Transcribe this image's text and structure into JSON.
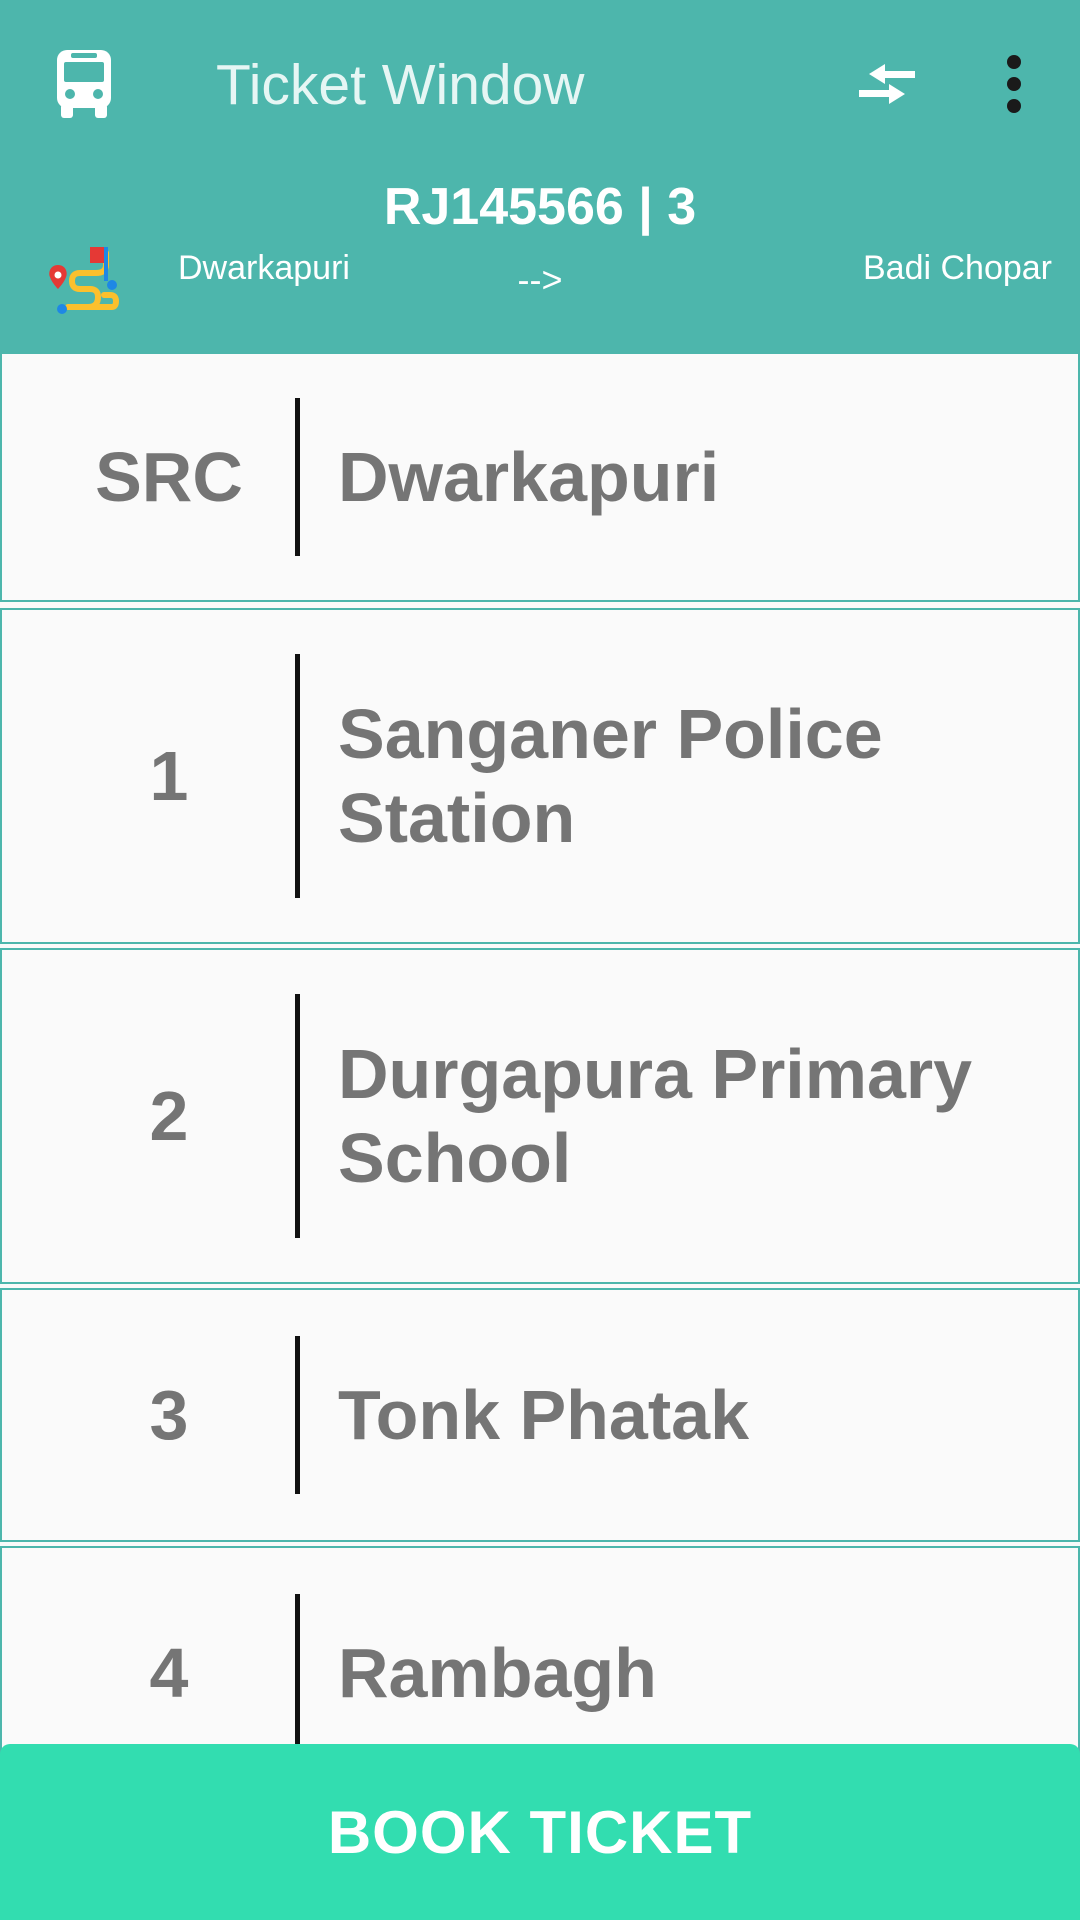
{
  "header": {
    "title": "Ticket Window",
    "route_code": "RJ145566 | 3",
    "source": "Dwarkapuri",
    "arrow": "-->",
    "destination": "Badi Chopar",
    "icons": {
      "left": "bus-icon",
      "swap": "swap-arrows-icon",
      "more": "more-vert-icon",
      "route": "route-map-icon"
    }
  },
  "stops": [
    {
      "index": "SRC",
      "name": "Dwarkapuri"
    },
    {
      "index": "1",
      "name": "Sanganer Police Station"
    },
    {
      "index": "2",
      "name": "Durgapura Primary School"
    },
    {
      "index": "3",
      "name": "Tonk Phatak"
    },
    {
      "index": "4",
      "name": "Rambagh"
    }
  ],
  "book_button": {
    "label": "BOOK TICKET"
  },
  "colors": {
    "header_bg": "#4db6ac",
    "row_border": "#4db6ac",
    "button_bg": "#32ddb0",
    "stop_text": "#757575"
  }
}
